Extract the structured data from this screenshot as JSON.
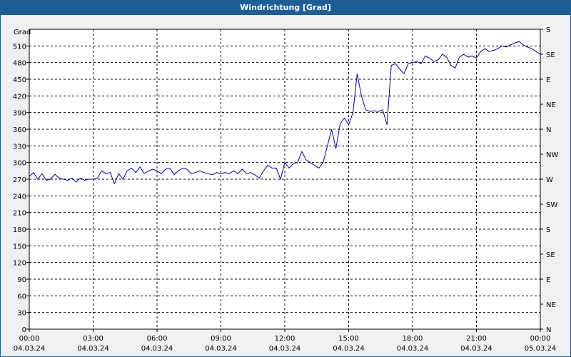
{
  "window": {
    "title": "Windrichtung [Grad]"
  },
  "chart_data": {
    "type": "line",
    "title": "Windrichtung [Grad]",
    "ylabel": "Grad",
    "xlabel": "",
    "ylim": [
      0,
      540
    ],
    "y_ticks": [
      0,
      30,
      60,
      90,
      120,
      150,
      180,
      210,
      240,
      270,
      300,
      330,
      360,
      390,
      420,
      450,
      480,
      510
    ],
    "x_hours_range": [
      0,
      24
    ],
    "x_ticks": [
      {
        "time": "00:00",
        "date": "04.03.24"
      },
      {
        "time": "03:00",
        "date": "04.03.24"
      },
      {
        "time": "06:00",
        "date": "04.03.24"
      },
      {
        "time": "09:00",
        "date": "04.03.24"
      },
      {
        "time": "12:00",
        "date": "04.03.24"
      },
      {
        "time": "15:00",
        "date": "04.03.24"
      },
      {
        "time": "18:00",
        "date": "04.03.24"
      },
      {
        "time": "21:00",
        "date": "04.03.24"
      },
      {
        "time": "00:00",
        "date": "05.03.24"
      }
    ],
    "right_axis_labels": [
      "N",
      "NE",
      "E",
      "SE",
      "S",
      "SW",
      "W",
      "NW",
      "N",
      "NE",
      "E",
      "SE",
      "S"
    ],
    "grid": true,
    "line_color": "#0000a0",
    "series": [
      {
        "x": [
          0,
          0.2,
          0.4,
          0.6,
          0.8,
          1.0,
          1.2,
          1.4,
          1.6,
          1.8,
          2.0,
          2.2,
          2.4,
          2.6,
          2.8,
          3.0,
          3.2,
          3.4,
          3.6,
          3.8,
          4.0,
          4.2,
          4.4,
          4.6,
          4.8,
          5.0,
          5.2,
          5.4,
          5.6,
          5.8,
          6.0,
          6.2,
          6.4,
          6.6,
          6.8,
          7.0,
          7.2,
          7.4,
          7.6,
          7.8,
          8.0,
          8.2,
          8.4,
          8.6,
          8.8,
          9.0,
          9.2,
          9.4,
          9.6,
          9.8,
          10.0,
          10.2,
          10.4,
          10.6,
          10.8,
          11.0,
          11.2,
          11.4,
          11.6,
          11.8,
          12.0,
          12.2,
          12.4,
          12.6,
          12.8,
          13.0,
          13.2,
          13.4,
          13.6,
          13.8,
          14.0,
          14.2,
          14.4,
          14.6,
          14.8,
          15.0,
          15.2,
          15.4,
          15.6,
          15.8,
          16.0,
          16.2,
          16.4,
          16.6,
          16.8,
          17.0,
          17.2,
          17.4,
          17.6,
          17.8,
          18.0,
          18.2,
          18.4,
          18.6,
          18.8,
          19.0,
          19.2,
          19.4,
          19.6,
          19.8,
          20.0,
          20.2,
          20.4,
          20.6,
          20.8,
          21.0,
          21.2,
          21.4,
          21.6,
          21.8,
          22.0,
          22.2,
          22.4,
          22.6,
          22.8,
          23.0,
          23.2,
          23.4,
          23.6,
          23.8,
          24.0
        ],
        "y": [
          275,
          282,
          270,
          280,
          268,
          270,
          279,
          272,
          270,
          268,
          272,
          265,
          272,
          268,
          270,
          270,
          272,
          285,
          280,
          282,
          262,
          280,
          270,
          285,
          290,
          282,
          292,
          280,
          285,
          288,
          285,
          280,
          288,
          290,
          278,
          285,
          290,
          288,
          280,
          282,
          285,
          282,
          280,
          278,
          282,
          280,
          282,
          280,
          285,
          280,
          288,
          280,
          282,
          278,
          272,
          285,
          295,
          290,
          290,
          270,
          300,
          290,
          298,
          300,
          320,
          305,
          300,
          295,
          290,
          300,
          330,
          360,
          325,
          370,
          380,
          368,
          390,
          460,
          420,
          395,
          392,
          393,
          392,
          395,
          368,
          475,
          478,
          468,
          460,
          478,
          480,
          482,
          478,
          492,
          488,
          482,
          485,
          495,
          490,
          475,
          470,
          490,
          495,
          490,
          492,
          488,
          500,
          505,
          500,
          502,
          505,
          510,
          508,
          512,
          515,
          518,
          512,
          508,
          505,
          500,
          495
        ]
      }
    ]
  }
}
